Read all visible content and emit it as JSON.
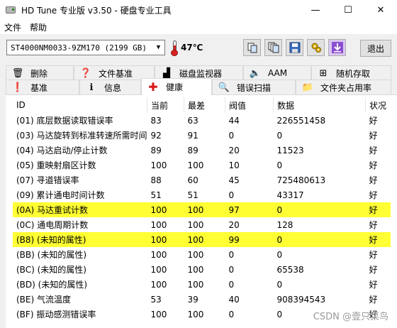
{
  "window": {
    "title": "HD Tune 专业版 v3.50 - 硬盘专业工具",
    "minimize": "—",
    "maximize": "☐",
    "close": "✕"
  },
  "menu": [
    "文件",
    "帮助"
  ],
  "toolbar": {
    "drive": "ST4000NM0033-9ZM170 (2199 GB)",
    "temperature": "47℃",
    "exit_label": "退出",
    "buttons": [
      "copy-icon",
      "copy-all-icon",
      "save-icon",
      "options-icon",
      "download-icon"
    ]
  },
  "tabs_row1": [
    {
      "label": "删除",
      "icon": "trash-icon"
    },
    {
      "label": "文件基准",
      "icon": "file-benchmark-icon"
    },
    {
      "label": "磁盘监视器",
      "icon": "monitor-icon"
    },
    {
      "label": "AAM",
      "icon": "speaker-icon"
    },
    {
      "label": "随机存取",
      "icon": "random-access-icon"
    }
  ],
  "tabs_row2": [
    {
      "label": "基准",
      "icon": "benchmark-icon"
    },
    {
      "label": "信息",
      "icon": "info-icon"
    },
    {
      "label": "健康",
      "icon": "health-cross-icon",
      "active": true
    },
    {
      "label": "错误扫描",
      "icon": "magnifier-icon"
    },
    {
      "label": "文件夹占用率",
      "icon": "folder-icon"
    }
  ],
  "table": {
    "headers": [
      "ID",
      "当前",
      "最差",
      "阀值",
      "数据",
      "状况"
    ],
    "rows": [
      {
        "id": "(01) 底层数据读取错误率",
        "cur": "83",
        "worst": "63",
        "thr": "44",
        "data": "226551458",
        "status": "好",
        "hl": false
      },
      {
        "id": "(03) 马达旋转到标准转速所需时间",
        "cur": "92",
        "worst": "91",
        "thr": "0",
        "data": "0",
        "status": "好",
        "hl": false
      },
      {
        "id": "(04) 马达启动/停止计数",
        "cur": "89",
        "worst": "89",
        "thr": "20",
        "data": "11523",
        "status": "好",
        "hl": false
      },
      {
        "id": "(05) 重映射扇区计数",
        "cur": "100",
        "worst": "100",
        "thr": "10",
        "data": "0",
        "status": "好",
        "hl": false
      },
      {
        "id": "(07) 寻道错误率",
        "cur": "88",
        "worst": "60",
        "thr": "45",
        "data": "725480613",
        "status": "好",
        "hl": false
      },
      {
        "id": "(09) 累计通电时间计数",
        "cur": "51",
        "worst": "51",
        "thr": "0",
        "data": "43317",
        "status": "好",
        "hl": false
      },
      {
        "id": "(0A) 马达重试计数",
        "cur": "100",
        "worst": "100",
        "thr": "97",
        "data": "0",
        "status": "好",
        "hl": true
      },
      {
        "id": "(0C) 通电周期计数",
        "cur": "100",
        "worst": "100",
        "thr": "20",
        "data": "128",
        "status": "好",
        "hl": false
      },
      {
        "id": "(B8) (未知的属性)",
        "cur": "100",
        "worst": "100",
        "thr": "99",
        "data": "0",
        "status": "好",
        "hl": true
      },
      {
        "id": "(BB) (未知的属性)",
        "cur": "100",
        "worst": "100",
        "thr": "0",
        "data": "0",
        "status": "好",
        "hl": false
      },
      {
        "id": "(BC) (未知的属性)",
        "cur": "100",
        "worst": "100",
        "thr": "0",
        "data": "65538",
        "status": "好",
        "hl": false
      },
      {
        "id": "(BD) (未知的属性)",
        "cur": "100",
        "worst": "100",
        "thr": "0",
        "data": "0",
        "status": "好",
        "hl": false
      },
      {
        "id": "(BE) 气流温度",
        "cur": "53",
        "worst": "39",
        "thr": "40",
        "data": "908394543",
        "status": "好",
        "hl": false
      },
      {
        "id": "(BF) 振动感测错误率",
        "cur": "100",
        "worst": "100",
        "thr": "0",
        "data": "0",
        "status": "好",
        "hl": false
      }
    ]
  },
  "watermark": "CSDN @壹只菜鸟"
}
